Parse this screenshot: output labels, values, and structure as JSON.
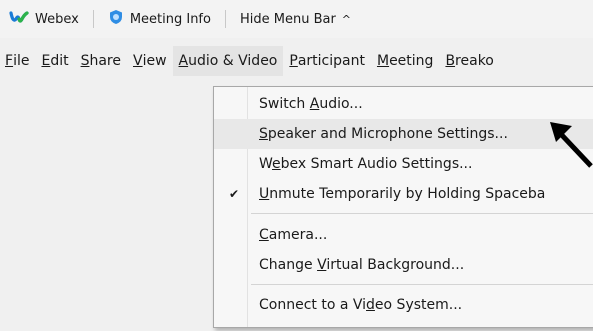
{
  "topbar": {
    "app_name": "Webex",
    "meeting_info_label": "Meeting Info",
    "hide_menu_label": "Hide Menu Bar",
    "chevron_glyph": "^"
  },
  "menubar": {
    "items": [
      {
        "ul": "F",
        "rest": "ile"
      },
      {
        "ul": "E",
        "rest": "dit"
      },
      {
        "ul": "S",
        "rest": "hare"
      },
      {
        "ul": "V",
        "rest": "iew"
      },
      {
        "ul": "A",
        "rest": "udio & Video"
      },
      {
        "ul": "P",
        "rest": "articipant"
      },
      {
        "ul": "M",
        "rest": "eeting"
      },
      {
        "ul": "B",
        "rest": "reako"
      }
    ]
  },
  "menu": {
    "items": [
      {
        "pre": "Switch ",
        "ul": "A",
        "post": "udio...",
        "checked": false
      },
      {
        "pre": "",
        "ul": "S",
        "post": "peaker and Microphone Settings...",
        "checked": false,
        "hover": true
      },
      {
        "pre": "W",
        "ul": "e",
        "post": "bex Smart Audio Settings...",
        "checked": false
      },
      {
        "pre": "",
        "ul": "U",
        "post": "nmute Temporarily by Holding Spaceba",
        "checked": true
      },
      {
        "pre": "",
        "ul": "C",
        "post": "amera...",
        "checked": false
      },
      {
        "pre": "Change ",
        "ul": "V",
        "post": "irtual Background...",
        "checked": false
      },
      {
        "pre": "Connect to a Vi",
        "ul": "d",
        "post": "eo System...",
        "checked": false
      }
    ],
    "check_glyph": "✔"
  },
  "colors": {
    "webex_blue": "#1a7bd6",
    "webex_green": "#2db34a",
    "info_blue": "#2f8de4"
  }
}
